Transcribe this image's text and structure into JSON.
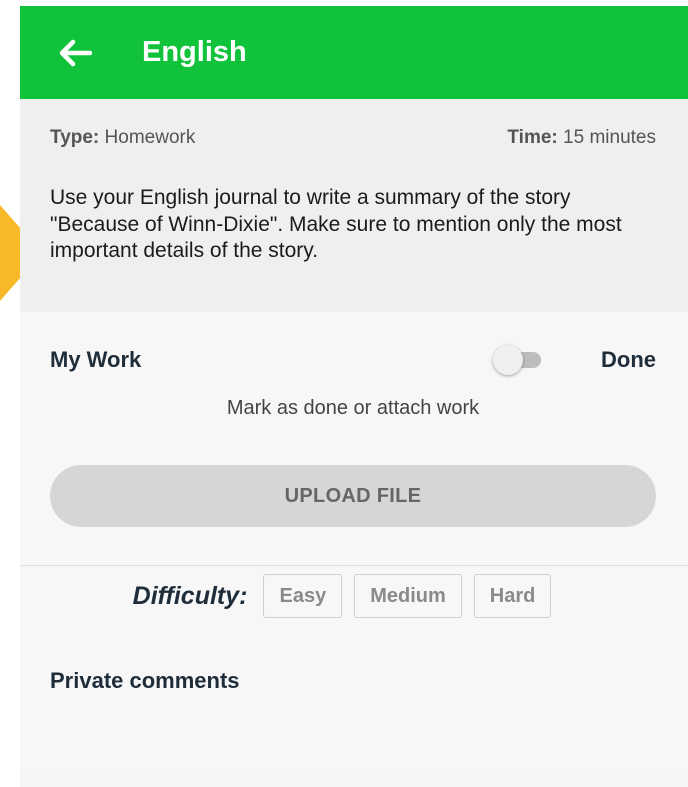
{
  "appbar": {
    "title": "English",
    "back_icon": "arrow-left-icon",
    "color": "#10c33b"
  },
  "assignment": {
    "type_label": "Type:",
    "type_value": "Homework",
    "time_label": "Time:",
    "time_value": "15 minutes",
    "description": "Use your English journal to write a summary of the story \"Because of Winn-Dixie\". Make sure to mention only the most important details of the story."
  },
  "work": {
    "label": "My Work",
    "done_label": "Done",
    "toggle_on": false,
    "hint": "Mark as done or attach work",
    "upload_label": "UPLOAD FILE"
  },
  "difficulty": {
    "label": "Difficulty:",
    "options": [
      "Easy",
      "Medium",
      "Hard"
    ]
  },
  "comments": {
    "label": "Private comments"
  }
}
